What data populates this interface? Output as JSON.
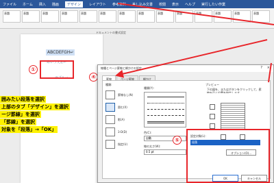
{
  "ribbon": {
    "tabs": [
      "ファイル",
      "ホーム",
      "挿入",
      "描画",
      "デザイン",
      "レイアウト",
      "参考資料",
      "差し込み文書",
      "校閲",
      "表示",
      "ヘルプ",
      "実行したい作業"
    ],
    "active_tab_index": 4,
    "styles": [
      "表題",
      "表題",
      "表題",
      "表題",
      "表題",
      "表題",
      "表題",
      "表題",
      "表題",
      "表題",
      "表題",
      "表題",
      "表題",
      "表題"
    ],
    "group_label": "ドキュメントの書式設定"
  },
  "document": {
    "selected_text": "ABCDEFGH↵",
    "faint_lines": [
      "あいうえお↵",
      "ラブル↵"
    ]
  },
  "annotations": {
    "step1": "①",
    "step4": "④",
    "step5": "⑤",
    "instructions": [
      "囲みたい段落を選択",
      "上部のタブ「デザイン」を選択",
      "ージ罫線」を選択",
      "「罫線」を選択",
      "対象を「段落」→「OK」"
    ]
  },
  "dialog": {
    "title": "線種とページ罫線と網かけの設定",
    "help": "?",
    "close": "×",
    "tabs": [
      "罫線",
      "ページ罫線",
      "網かけ"
    ],
    "active_tab": 0,
    "setting_label": "種類:",
    "settings": [
      "罫線なし(N)",
      "囲む(X)",
      "影(A)",
      "3-D(D)",
      "指定(U)"
    ],
    "line_style_label": "種類(Y):",
    "color_label": "色(C):",
    "color_value": "自動",
    "width_label": "線の太さ(W):",
    "width_value": "0.5 pt",
    "preview_label": "プレビュー",
    "preview_hint": "下の図を、またはボタンをクリックして、罫線を引く位置を指定します。",
    "apply_label": "設定対象(L):",
    "apply_value": "段落",
    "options_button": "オプション(O)...",
    "ok_button": "OK",
    "cancel_button": "キャンセル"
  },
  "colors": {
    "accent": "#2b579a",
    "annotation_red": "#e8252a",
    "highlight": "#fff200",
    "selection": "#1a62c5"
  }
}
